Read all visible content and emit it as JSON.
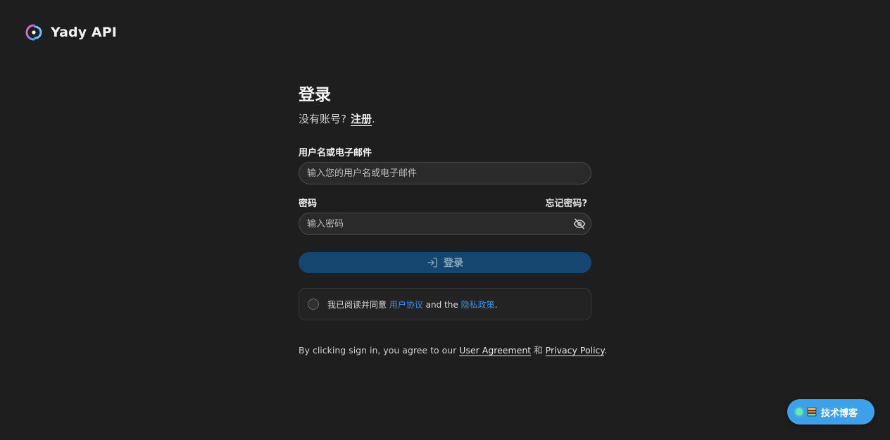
{
  "brand": {
    "name": "Yady API"
  },
  "login": {
    "title": "登录",
    "no_account": "没有账号?",
    "register_link": "注册",
    "period": "."
  },
  "form": {
    "username_label": "用户名或电子邮件",
    "username_placeholder": "输入您的用户名或电子邮件",
    "password_label": "密码",
    "forgot_link": "忘记密码?",
    "password_placeholder": "输入密码",
    "submit_label": "登录"
  },
  "agreement": {
    "prefix": "我已阅读并同意 ",
    "user_agreement": "用户协议",
    "middle": " and the ",
    "privacy_policy": "隐私政策",
    "suffix": "."
  },
  "footnote": {
    "prefix": "By clicking sign in, you agree to our ",
    "user_agreement": "User Agreement",
    "middle": " 和 ",
    "privacy_policy": "Privacy Policy",
    "suffix": "."
  },
  "floating": {
    "label": "技术博客"
  },
  "colors": {
    "background": "#1e1e1e",
    "primary_button": "#15466f",
    "link_blue": "#3c8fe0",
    "floating_button": "#3ea0e8"
  }
}
